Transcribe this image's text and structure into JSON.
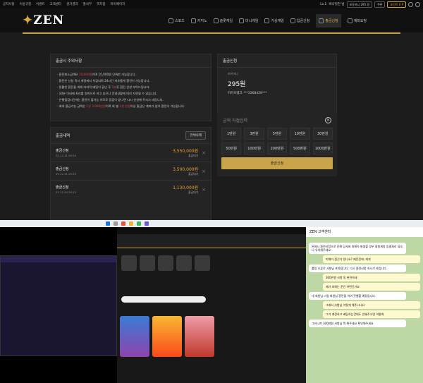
{
  "util": {
    "links": [
      "공지사항",
      "이용규정",
      "이벤트",
      "고객센터",
      "경기결과",
      "출석부",
      "쪽지함",
      "마이페이지"
    ],
    "level": "Lv.1",
    "user": "비나잇진 님",
    "pills": [
      "보유머니 295 원",
      "쿠폰",
      "포인트 0 P"
    ]
  },
  "logo": "ZEN",
  "menu": [
    "스포츠",
    "카지노",
    "슬롯게임",
    "미니게임",
    "가상게임",
    "입금신청",
    "출금신청",
    "계좌요청"
  ],
  "notice": {
    "title": "출금시 주의사항",
    "lines": [
      [
        "환전최소금액은 ",
        "10,000원",
        "이며 10,000원 단위만 가능합니다."
      ],
      [
        "환전은 신청 즉시 계정에서 차감되며 24시간 자유롭게 환전이 가능합니다.",
        "",
        ""
      ],
      [
        "원활한 환전을 위해 마지막 베팅이 끝난 후 ",
        "5분",
        "후 환전 신청 부탁드립니다."
      ],
      [
        "10분 이내에 처리를 원칙으로 하고 있으나 운영상황에 따라 지연될 수 있습니다.",
        "",
        ""
      ],
      [
        "은행점검시간에는 환전이 불가능 하므로 점검이 끝나면 다시 신청해 주시기 바랍니다.",
        "",
        ""
      ],
      [
        "최대 출금가능 금액은 ",
        "1일 3,000만원",
        "이며 회 별 ",
        "1천 만원",
        "이상 출금은 계좌가 없어 환전이 가능합니다."
      ]
    ]
  },
  "history": {
    "title": "출금내역",
    "btn": "전체삭제",
    "rows": [
      {
        "t": "출금신청",
        "d": "25.12.31 00:54",
        "amt": "3,550,000원",
        "st": "출금대기"
      },
      {
        "t": "출금신청",
        "d": "25.12.31 00:53",
        "amt": "3,500,000원",
        "st": "출금대기"
      },
      {
        "t": "출금신청",
        "d": "25.12.30 04:12",
        "amt": "1,130,000원",
        "st": "출금대기"
      }
    ]
  },
  "apply": {
    "title": "출금신청",
    "money_label": "보유머니",
    "money": "295원",
    "bank": "카카오뱅크 ***3268429***",
    "input_ph": "금액 직접입력",
    "amounts": [
      "1만원",
      "3만원",
      "5만원",
      "10만원",
      "30만원",
      "50만원",
      "100만원",
      "200만원",
      "500만원",
      "1000만원"
    ],
    "submit": "출금신청"
  },
  "chat": {
    "title": "ZEN 고객센터",
    "msgs": [
      {
        "who": "them",
        "text": "온레시 환전신청으로 인해 당사에 피해가 발생할 경우 회원계정 동결처리 되오니 유의해주세요."
      },
      {
        "who": "me",
        "text": "피해가 생긴거 있나요? 제문전에..게져"
      },
      {
        "who": "them",
        "text": "롤링 오류로 사항님 초과됩니다. 다시 환전신청 하시기 바랍니다."
      },
      {
        "who": "me",
        "text": "300만원 사항 동 완전하세"
      },
      {
        "who": "me",
        "text": "제가 피해는 준건 어떤건가요"
      },
      {
        "who": "them",
        "text": "네 회원님 그럼 회원님 환전을 하여 진행할 예정입니다."
      },
      {
        "who": "me",
        "text": "그래서 사항님 어떻게 해주시나요"
      },
      {
        "who": "me",
        "text": "그거 계정하고 베팅하는건데도 안돼주시면 어떻게"
      },
      {
        "who": "them",
        "text": "그러니까 300만원 사항님 뭐 해주세요 확인해주세요"
      }
    ]
  }
}
